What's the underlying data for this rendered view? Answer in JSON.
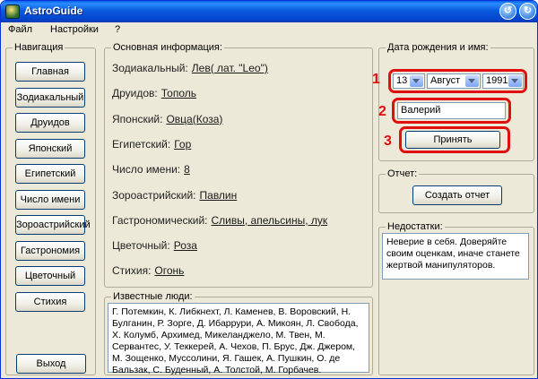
{
  "window": {
    "title": "AstroGuide",
    "minimize_glyph": "↺",
    "close_glyph": "↻"
  },
  "menu": [
    "Файл",
    "Настройки",
    "?"
  ],
  "nav": {
    "legend": "Навигация",
    "items": [
      "Главная",
      "Зодиакальный",
      "Друидов",
      "Японский",
      "Египетский",
      "Число имени",
      "Зороастрийский",
      "Гастрономия",
      "Цветочный",
      "Стихия"
    ],
    "exit": "Выход"
  },
  "info": {
    "legend": "Основная информация:",
    "rows": [
      {
        "label": "Зодиакальный:",
        "value": "Лев( лат. \"Leo\")"
      },
      {
        "label": "Друидов:",
        "value": "Тополь"
      },
      {
        "label": "Японский:",
        "value": "Овца(Коза)"
      },
      {
        "label": "Египетский:",
        "value": "Гор"
      },
      {
        "label": "Число имени:",
        "value": "8"
      },
      {
        "label": "Зороастрийский:",
        "value": "Павлин"
      },
      {
        "label": "Гастрономический:",
        "value": "Сливы, апельсины, лук"
      },
      {
        "label": "Цветочный:",
        "value": "Роза"
      },
      {
        "label": "Стихия:",
        "value": "Огонь"
      }
    ]
  },
  "birth": {
    "legend": "Дата рождения и имя:",
    "day": "13",
    "month": "Август",
    "year": "1991",
    "name_value": "Валерий",
    "accept": "Принять",
    "annotations": [
      "1",
      "2",
      "3"
    ]
  },
  "report": {
    "legend": "Отчет:",
    "button": "Создать отчет"
  },
  "flaws": {
    "legend": "Недостатки:",
    "text": "Неверие в себя. Доверяйте своим оценкам, иначе станете жертвой манипуляторов."
  },
  "famous": {
    "legend": "Известные люди:",
    "text": "Г. Потемкин, К. Либкнехт, Л. Каменев, В. Воровский, Н. Булганин, Р. Зорге, Д. Ибаррури, А. Микоян, Л. Свобода, Х. Колумб, Архимед, Микеланджело, М. Твен, М. Сервантес, У. Теккерей, А. Чехов, П. Брус, Дж. Джером, М. Зощенко, Муссолини, Я. Гашек, А. Пушкин, О. де Бальзак, С. Буденный, А. Толстой, М. Горбачев."
  }
}
